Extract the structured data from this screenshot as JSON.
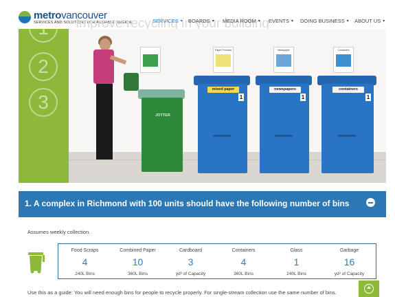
{
  "header": {
    "logo_text_strong": "metro",
    "logo_text_rest": "vancouver",
    "logo_tagline": "SERVICES AND SOLUTIONS FOR A LIVABLE REGION",
    "ghost_title": "Improve recycling in your building",
    "nav": [
      {
        "label": "SERVICES",
        "active": true
      },
      {
        "label": "BOARDS",
        "active": false
      },
      {
        "label": "MEDIA ROOM",
        "active": false
      },
      {
        "label": "EVENTS",
        "active": false
      },
      {
        "label": "DOING BUSINESS",
        "active": false
      },
      {
        "label": "ABOUT US",
        "active": false
      }
    ]
  },
  "hero": {
    "steps": [
      "1",
      "2",
      "3"
    ],
    "signs": [
      "",
      "Paper Products",
      "Newspaper",
      "Containers"
    ],
    "bins": [
      {
        "label": "",
        "number": "",
        "color": "#2a8a3a"
      },
      {
        "label": "mixed paper",
        "number": "1",
        "color": "#2a74c6"
      },
      {
        "label": "newspapers",
        "number": "1",
        "color": "#2a74c6"
      },
      {
        "label": "containers",
        "number": "1",
        "color": "#2a74c6"
      }
    ],
    "green_bin_text": "JOTTER"
  },
  "section": {
    "title": "1. A complex in Richmond with 100 units should have the following number of bins",
    "assumes": "Assumes weekly collection.",
    "columns": [
      {
        "header": "Food Scraps",
        "value": "4",
        "unit": "240L Bins"
      },
      {
        "header": "Combined Paper",
        "value": "10",
        "unit": "360L Bins"
      },
      {
        "header": "Cardboard",
        "value": "3",
        "unit": "yd³ of Capacity"
      },
      {
        "header": "Containers",
        "value": "4",
        "unit": "360L Bins"
      },
      {
        "header": "Glass",
        "value": "1",
        "unit": "240L Bins"
      },
      {
        "header": "Garbage",
        "value": "16",
        "unit": "yd³ of Capacity"
      }
    ],
    "guide": "Use this as a guide: You will need enough bins for people to recycle properly. For single-stream collection use the same number of bins."
  },
  "colors": {
    "accent_blue": "#2b78b5",
    "accent_green": "#8db83a",
    "value_blue": "#2f7ec0"
  }
}
